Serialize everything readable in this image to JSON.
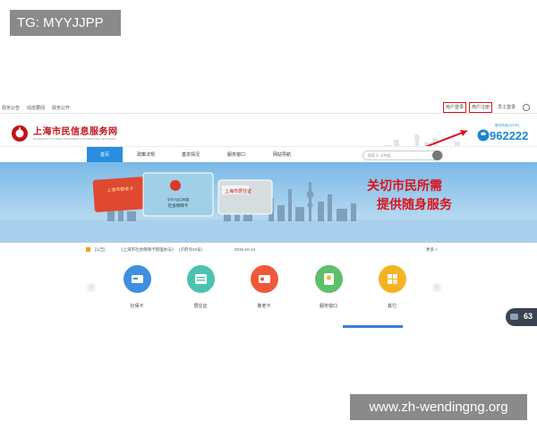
{
  "watermark_top": "TG: MYYJJPP",
  "watermark_bottom": "www.zh-wendingng.org",
  "topbar": {
    "left_links": [
      "政务公告",
      "动态要闻",
      "政务公开"
    ],
    "right_links": [
      "用户登录",
      "用户注册",
      "员工登录"
    ]
  },
  "header": {
    "site_name": "上海市民信息服务网",
    "site_subtitle": "SHANGHAI CITIZEN INFORMATION SERVICE NETWORK",
    "hotline_label": "服务热线(24小时)",
    "hotline": "962222"
  },
  "nav": {
    "items": [
      "首页",
      "政策法规",
      "基本情况",
      "服务窗口",
      "网站导航"
    ],
    "search_placeholder": "搜索卡·卡种类"
  },
  "banner": {
    "slogan_line1": "关切市民所需",
    "slogan_line2": "提供随身服务",
    "card1_title": "上海市敬老卡",
    "card2_title": "中华人民共和国",
    "card2_sub": "社会保障卡",
    "card3_title": "上海市居住证"
  },
  "notice": {
    "tag": "[公告]",
    "text": "《上海市社会保障卡管理办法》",
    "extra": "(沪府令22号)",
    "date": "2015-10-14",
    "more": "更多 >"
  },
  "services": [
    {
      "label": "社保卡",
      "color": "#3f8fe0"
    },
    {
      "label": "居住证",
      "color": "#4cc3b0"
    },
    {
      "label": "敬老卡",
      "color": "#f0583a"
    },
    {
      "label": "服务窗口",
      "color": "#5cbf6a"
    },
    {
      "label": "其它",
      "color": "#f4b323"
    }
  ],
  "floating_widget": {
    "text": "63"
  },
  "colors": {
    "brand_red": "#c0121a",
    "accent_blue": "#2a8ee0",
    "highlight_red": "#d9141c"
  }
}
